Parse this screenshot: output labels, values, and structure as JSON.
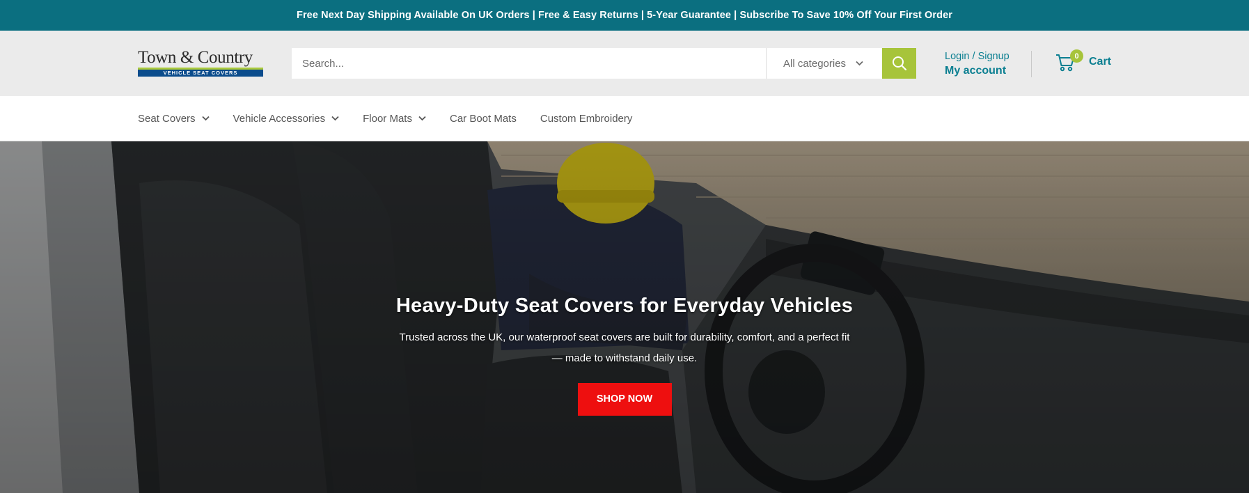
{
  "announcement": {
    "text": "Free Next Day Shipping Available On UK Orders | Free & Easy Returns | 5-Year Guarantee | Subscribe To Save 10% Off Your First Order"
  },
  "header": {
    "logo": {
      "title": "Town & Country",
      "subtitle": "VEHICLE SEAT COVERS"
    },
    "search": {
      "placeholder": "Search...",
      "category": "All categories"
    },
    "account": {
      "login": "Login / Signup",
      "my_account": "My account"
    },
    "cart": {
      "count": "0",
      "label": "Cart"
    }
  },
  "nav": {
    "items": [
      {
        "label": "Seat Covers",
        "dropdown": true
      },
      {
        "label": "Vehicle Accessories",
        "dropdown": true
      },
      {
        "label": "Floor Mats",
        "dropdown": true
      },
      {
        "label": "Car Boot Mats",
        "dropdown": false
      },
      {
        "label": "Custom Embroidery",
        "dropdown": false
      }
    ]
  },
  "hero": {
    "title": "Heavy-Duty Seat Covers for Everyday Vehicles",
    "subtitle": "Trusted across the UK, our waterproof seat covers are built for durability, comfort, and a perfect fit — made to withstand daily use.",
    "button": "SHOP NOW"
  },
  "colors": {
    "announcement_bg": "#0b6f80",
    "accent_green": "#a7c43a",
    "link_teal": "#0b7f91",
    "cta_red": "#ee0f0f"
  },
  "icons": [
    "search-icon",
    "chevron-down-icon",
    "cart-icon"
  ]
}
